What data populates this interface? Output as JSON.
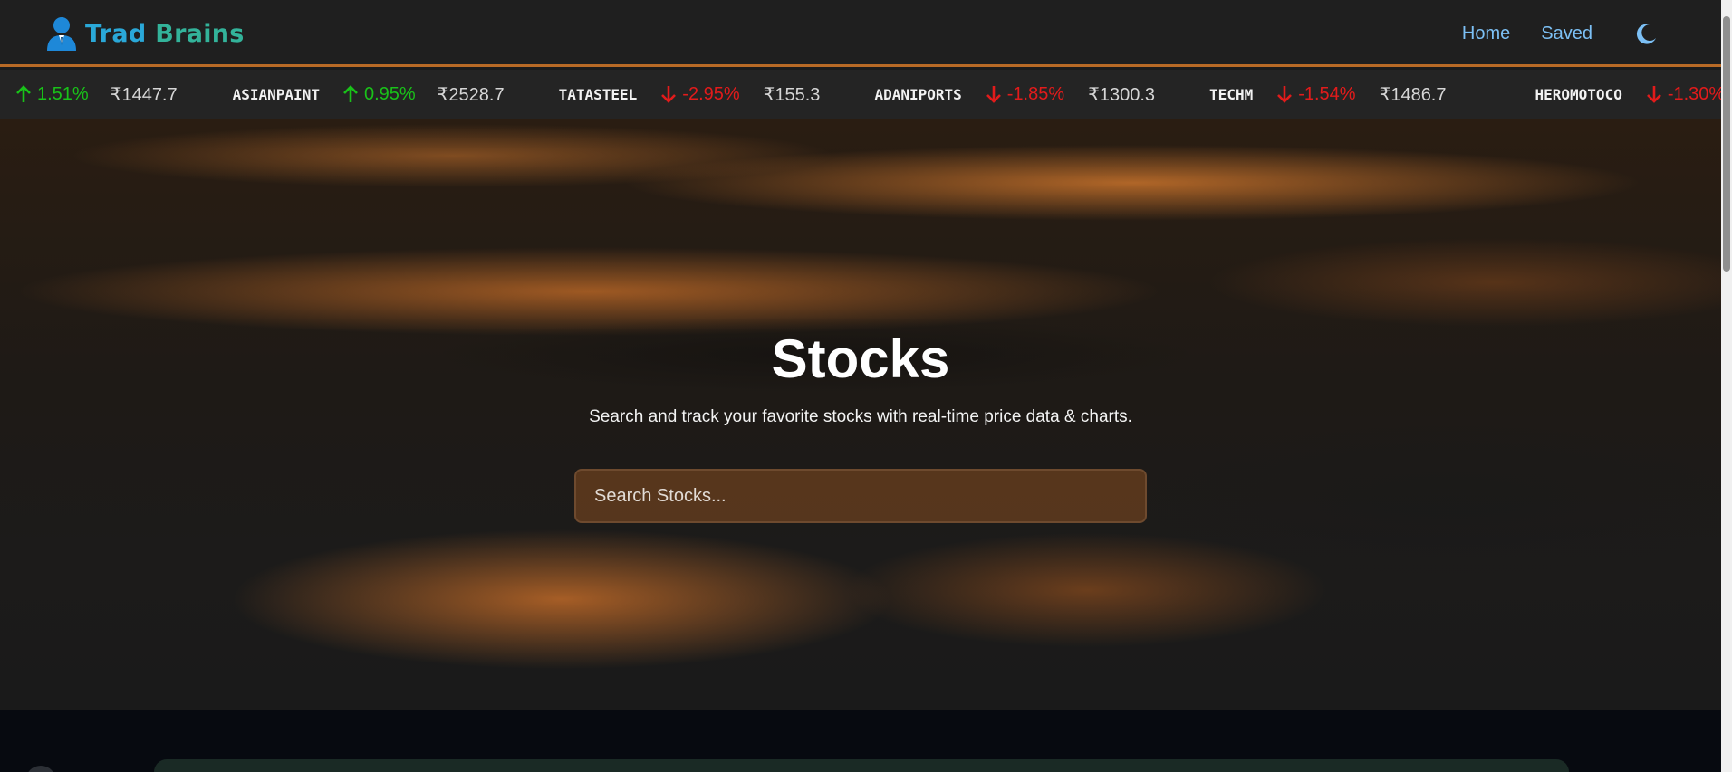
{
  "header": {
    "brand_part1": "Trad",
    "brand_part2": "Brains",
    "nav": [
      "Home",
      "Saved"
    ],
    "theme_toggle_icon": "moon-icon",
    "logo_icon": "businessman-icon"
  },
  "ticker": [
    {
      "symbol": "",
      "change": "1.51%",
      "direction": "up",
      "price": "₹1447.7"
    },
    {
      "symbol": "ASIANPAINT",
      "change": "0.95%",
      "direction": "up",
      "price": "₹2528.7"
    },
    {
      "symbol": "TATASTEEL",
      "change": "-2.95%",
      "direction": "down",
      "price": "₹155.3"
    },
    {
      "symbol": "ADANIPORTS",
      "change": "-1.85%",
      "direction": "down",
      "price": "₹1300.3"
    },
    {
      "symbol": "TECHM",
      "change": "-1.54%",
      "direction": "down",
      "price": "₹1486.7"
    },
    {
      "symbol": "HEROMOTOCO",
      "change": "-1.30%",
      "direction": "down",
      "price": ""
    }
  ],
  "hero": {
    "title": "Stocks",
    "subtitle": "Search and track your favorite stocks with real-time price data & charts.",
    "search_placeholder": "Search Stocks..."
  },
  "colors": {
    "up": "#19c219",
    "down": "#e21b1b",
    "nav_link": "#7cc0f5",
    "accent_orange": "#b86a26"
  }
}
